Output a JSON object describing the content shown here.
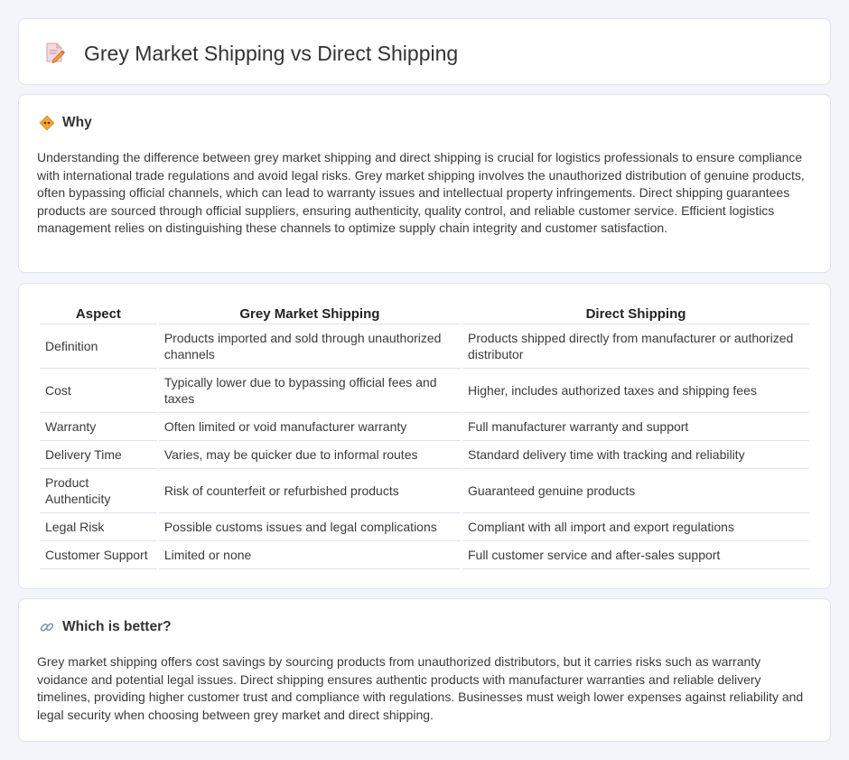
{
  "header": {
    "title": "Grey Market Shipping vs Direct Shipping",
    "icon": "document-pencil-icon"
  },
  "why": {
    "title": "Why",
    "icon": "diamond-sign-icon",
    "text": "Understanding the difference between grey market shipping and direct shipping is crucial for logistics professionals to ensure compliance with international trade regulations and avoid legal risks. Grey market shipping involves the unauthorized distribution of genuine products, often bypassing official channels, which can lead to warranty issues and intellectual property infringements. Direct shipping guarantees products are sourced through official suppliers, ensuring authenticity, quality control, and reliable customer service. Efficient logistics management relies on distinguishing these channels to optimize supply chain integrity and customer satisfaction."
  },
  "comparison": {
    "headers": [
      "Aspect",
      "Grey Market Shipping",
      "Direct Shipping"
    ],
    "rows": [
      [
        "Definition",
        "Products imported and sold through unauthorized channels",
        "Products shipped directly from manufacturer or authorized distributor"
      ],
      [
        "Cost",
        "Typically lower due to bypassing official fees and taxes",
        "Higher, includes authorized taxes and shipping fees"
      ],
      [
        "Warranty",
        "Often limited or void manufacturer warranty",
        "Full manufacturer warranty and support"
      ],
      [
        "Delivery Time",
        "Varies, may be quicker due to informal routes",
        "Standard delivery time with tracking and reliability"
      ],
      [
        "Product Authenticity",
        "Risk of counterfeit or refurbished products",
        "Guaranteed genuine products"
      ],
      [
        "Legal Risk",
        "Possible customs issues and legal complications",
        "Compliant with all import and export regulations"
      ],
      [
        "Customer Support",
        "Limited or none",
        "Full customer service and after-sales support"
      ]
    ]
  },
  "better": {
    "title": "Which is better?",
    "icon": "link-icon",
    "text": "Grey market shipping offers cost savings by sourcing products from unauthorized distributors, but it carries risks such as warranty voidance and potential legal issues. Direct shipping ensures authentic products with manufacturer warranties and reliable delivery timelines, providing higher customer trust and compliance with regulations. Businesses must weigh lower expenses against reliability and legal security when choosing between grey market and direct shipping."
  }
}
